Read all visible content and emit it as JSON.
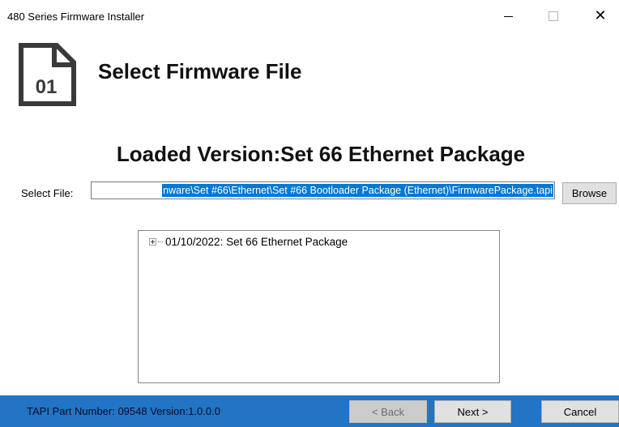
{
  "window": {
    "title": "480 Series Firmware Installer",
    "minimize_icon": "minimize-icon",
    "maximize_icon": "maximize-icon",
    "close_symbol": "✕"
  },
  "header": {
    "icon_text": "01",
    "title": "Select Firmware File"
  },
  "loaded_version": "Loaded Version:Set 66 Ethernet Package",
  "select_file": {
    "label": "Select File:",
    "value": "nware\\Set #66\\Ethernet\\Set #66 Bootloader Package (Ethernet)\\FirmwarePackage.tapi",
    "browse_label": "Browse"
  },
  "tree": {
    "items": [
      {
        "label": "01/10/2022: Set 66 Ethernet Package",
        "expanded": false
      }
    ]
  },
  "footer": {
    "part_info": "TAPI Part Number: 09548  Version:1.0.0.0",
    "back_label": "< Back",
    "next_label": "Next >",
    "cancel_label": "Cancel"
  },
  "colors": {
    "footer_bg": "#2274c5",
    "selection": "#0078d7"
  }
}
